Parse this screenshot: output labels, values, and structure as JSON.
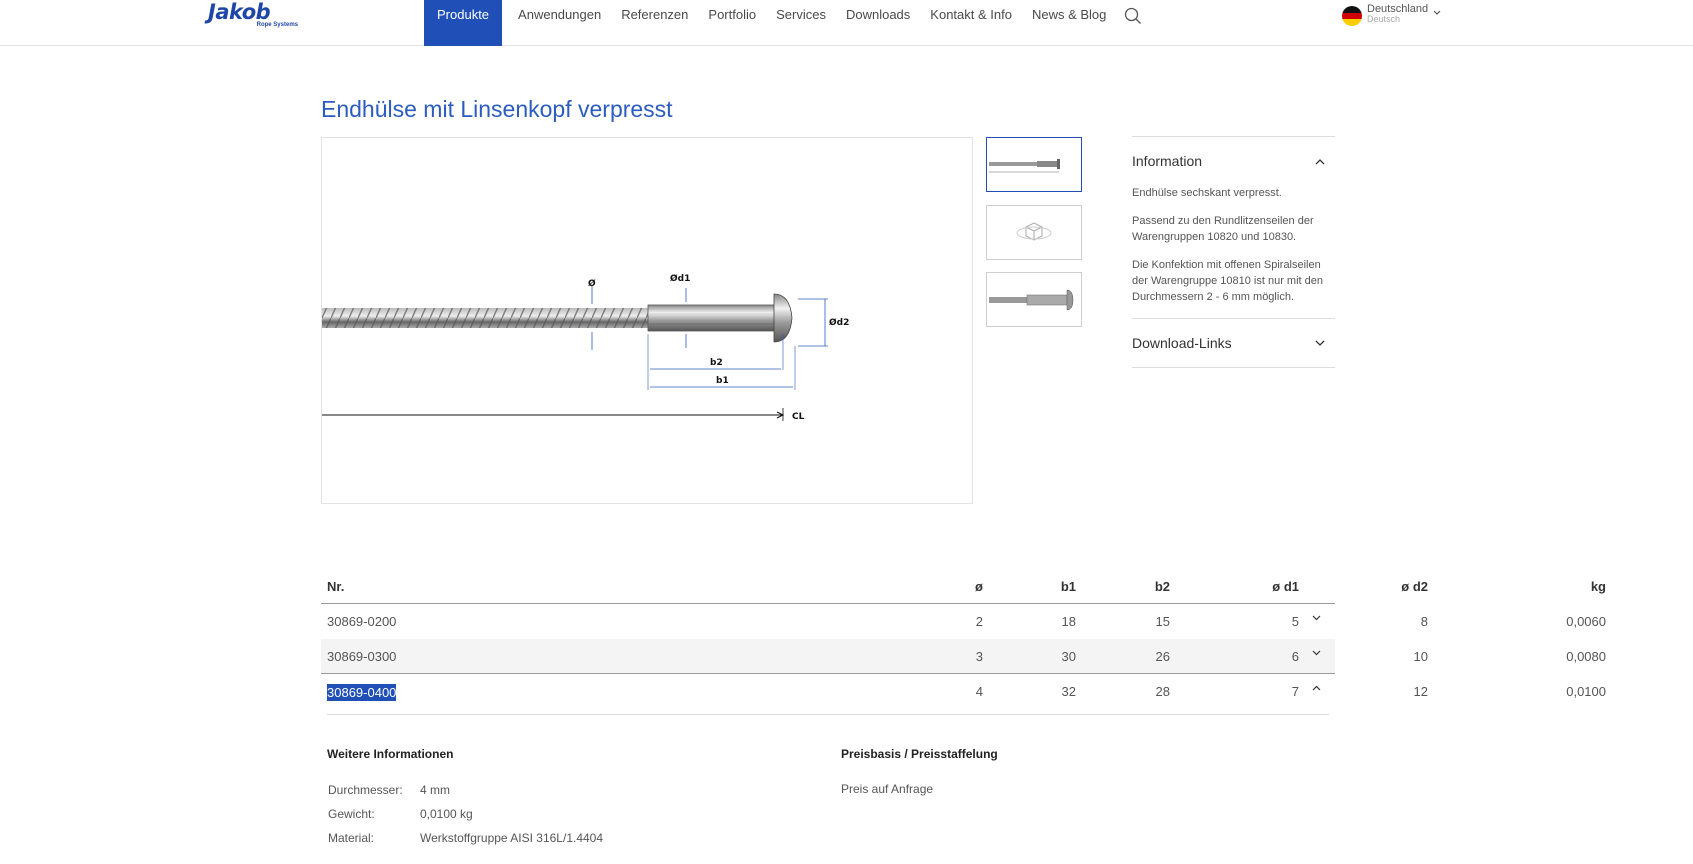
{
  "header": {
    "logo_text": "Jakob",
    "logo_sub": "Rope Systems",
    "nav": [
      "Produkte",
      "Anwendungen",
      "Referenzen",
      "Portfolio",
      "Services",
      "Downloads",
      "Kontakt & Info",
      "News & Blog"
    ],
    "active_nav": "Produkte",
    "language": {
      "country": "Deutschland",
      "lang": "Deutsch"
    }
  },
  "product": {
    "title": "Endhülse mit Linsenkopf verpresst",
    "drawing_labels": {
      "d": "Ø",
      "d1": "Ød1",
      "d2": "Ød2",
      "b1": "b1",
      "b2": "b2",
      "cl": "CL"
    }
  },
  "info": {
    "information_title": "Information",
    "paragraphs": [
      "Endhülse sechskant verpresst.",
      "Passend zu den Rundlitzenseilen der Warengruppen 10820 und 10830.",
      "Die Konfektion mit offenen Spiralseilen der Warengruppe 10810 ist nur mit den Durchmessern 2 - 6 mm möglich."
    ],
    "downloads_title": "Download-Links"
  },
  "table": {
    "headers": {
      "nr": "Nr.",
      "d": "ø",
      "b1": "b1",
      "b2": "b2",
      "d1": "ø d1",
      "d2": "ø d2",
      "kg": "kg"
    },
    "rows": [
      {
        "nr": "30869-0200",
        "d": "2",
        "b1": "18",
        "b2": "15",
        "d1": "5",
        "d2": "8",
        "kg": "0,0060"
      },
      {
        "nr": "30869-0300",
        "d": "3",
        "b1": "30",
        "b2": "26",
        "d1": "6",
        "d2": "10",
        "kg": "0,0080"
      },
      {
        "nr": "30869-0400",
        "d": "4",
        "b1": "32",
        "b2": "28",
        "d1": "7",
        "d2": "12",
        "kg": "0,0100"
      }
    ]
  },
  "details": {
    "more_title": "Weitere Informationen",
    "fields": [
      {
        "label": "Durchmesser:",
        "value": "4 mm"
      },
      {
        "label": "Gewicht:",
        "value": "0,0100 kg"
      },
      {
        "label": "Material:",
        "value": "Werkstoffgruppe AISI 316L/1.4404"
      }
    ],
    "price_title": "Preisbasis / Preisstaffelung",
    "price_value": "Preis auf Anfrage"
  },
  "colors": {
    "brand_blue": "#1f4fb7",
    "title_blue": "#2c5cbf"
  }
}
